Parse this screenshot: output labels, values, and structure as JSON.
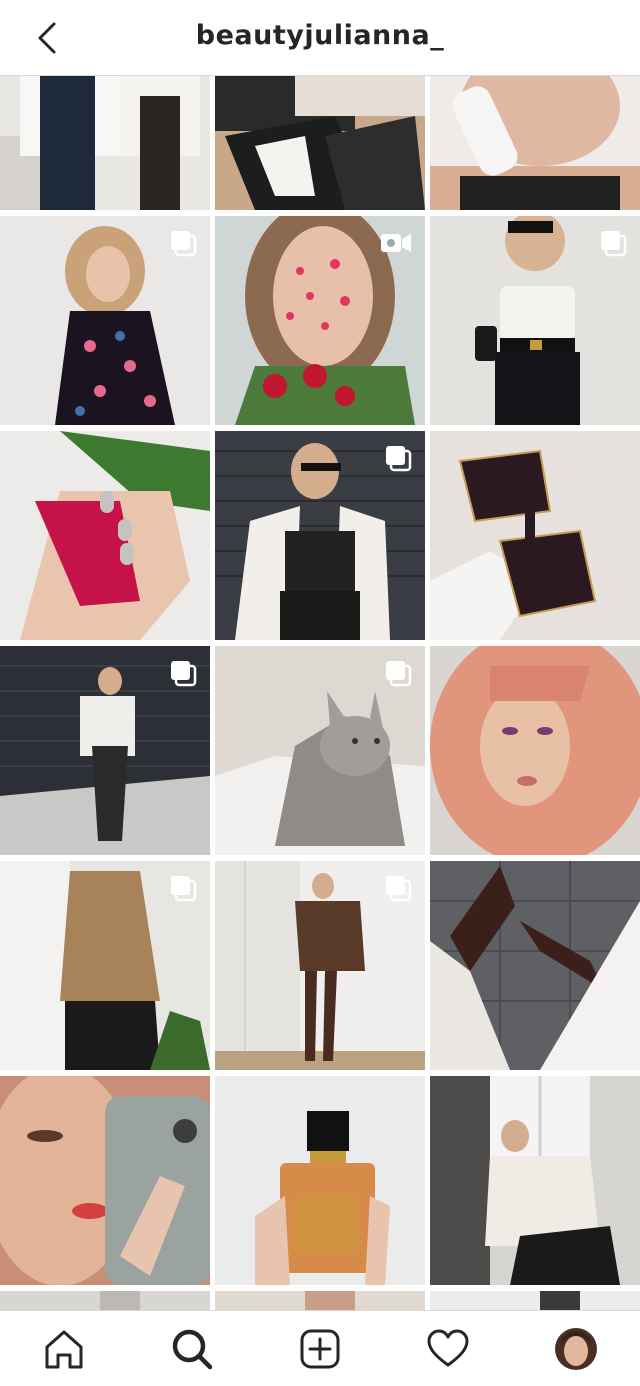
{
  "header": {
    "title": "beautyjulianna_",
    "back_icon": "chevron-left-icon"
  },
  "grid": {
    "tiles": [
      {
        "row": 0,
        "col": 0,
        "badge": "none",
        "desc": "outfit-photo"
      },
      {
        "row": 0,
        "col": 1,
        "badge": "none",
        "desc": "shoes-photo"
      },
      {
        "row": 0,
        "col": 2,
        "badge": "none",
        "desc": "selfie-phone-photo"
      },
      {
        "row": 1,
        "col": 0,
        "badge": "carousel",
        "desc": "floral-dress-photo"
      },
      {
        "row": 1,
        "col": 1,
        "badge": "video",
        "desc": "petal-face-photo"
      },
      {
        "row": 1,
        "col": 2,
        "badge": "carousel",
        "desc": "corset-outfit-photo"
      },
      {
        "row": 2,
        "col": 0,
        "badge": "none",
        "desc": "nails-rose-photo"
      },
      {
        "row": 2,
        "col": 1,
        "badge": "carousel",
        "desc": "leather-corset-photo"
      },
      {
        "row": 2,
        "col": 2,
        "badge": "none",
        "desc": "sunglasses-photo"
      },
      {
        "row": 3,
        "col": 0,
        "badge": "carousel",
        "desc": "street-outfit-photo"
      },
      {
        "row": 3,
        "col": 1,
        "badge": "carousel",
        "desc": "cat-photo"
      },
      {
        "row": 3,
        "col": 2,
        "badge": "none",
        "desc": "pink-hair-portrait-photo"
      },
      {
        "row": 4,
        "col": 0,
        "badge": "carousel",
        "desc": "back-hair-photo"
      },
      {
        "row": 4,
        "col": 1,
        "badge": "carousel",
        "desc": "brown-blazer-photo"
      },
      {
        "row": 4,
        "col": 2,
        "badge": "none",
        "desc": "boots-photo"
      },
      {
        "row": 5,
        "col": 0,
        "badge": "none",
        "desc": "mirror-selfie-photo"
      },
      {
        "row": 5,
        "col": 1,
        "badge": "none",
        "desc": "perfume-photo"
      },
      {
        "row": 5,
        "col": 2,
        "badge": "none",
        "desc": "window-pose-photo"
      },
      {
        "row": 6,
        "col": 0,
        "badge": "none",
        "desc": "partial-photo"
      },
      {
        "row": 6,
        "col": 1,
        "badge": "none",
        "desc": "partial-photo"
      },
      {
        "row": 6,
        "col": 2,
        "badge": "none",
        "desc": "partial-photo"
      }
    ]
  },
  "bottom_nav": {
    "items": [
      "home-icon",
      "search-icon",
      "new-post-icon",
      "activity-heart-icon",
      "profile-avatar"
    ]
  },
  "colors": {
    "divider": "#dbdbdb",
    "icon": "#262626"
  }
}
